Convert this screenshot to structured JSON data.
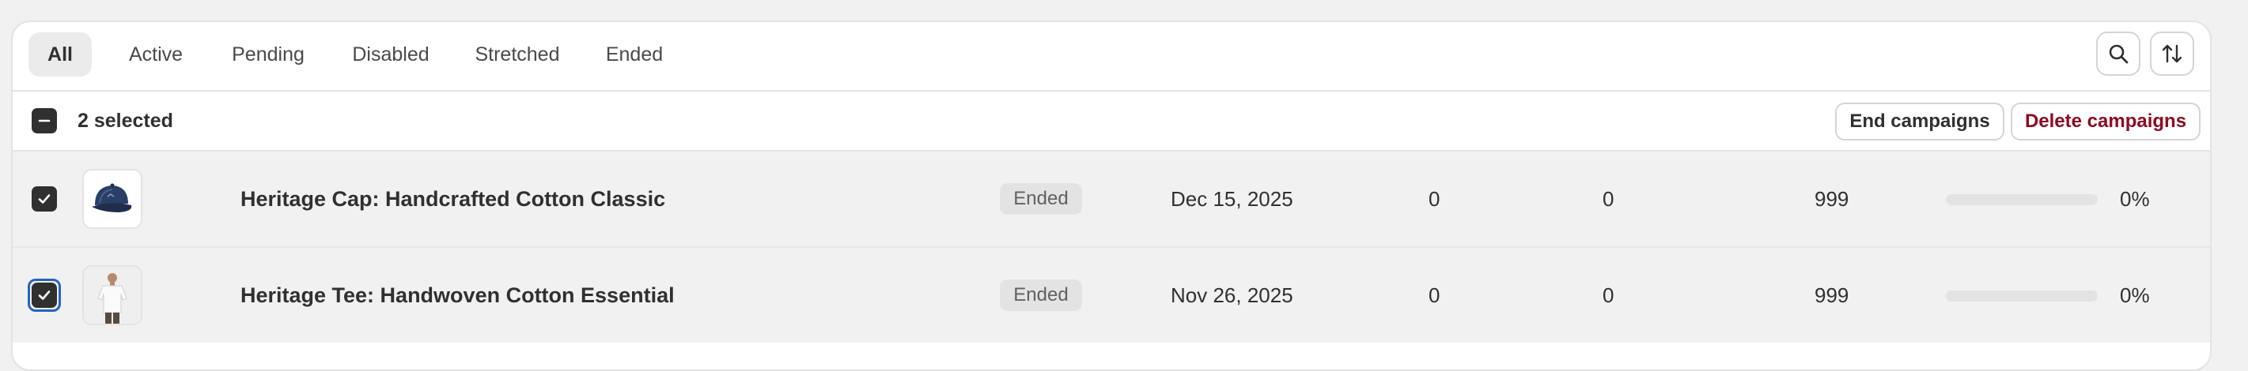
{
  "tabs": [
    {
      "label": "All",
      "active": true
    },
    {
      "label": "Active",
      "active": false
    },
    {
      "label": "Pending",
      "active": false
    },
    {
      "label": "Disabled",
      "active": false
    },
    {
      "label": "Stretched",
      "active": false
    },
    {
      "label": "Ended",
      "active": false
    }
  ],
  "toolbar": {
    "search_icon": "search-icon",
    "sort_icon": "sort-icon"
  },
  "bulk": {
    "selected_label": "2 selected",
    "end_button": "End campaigns",
    "delete_button": "Delete campaigns",
    "colors": {
      "primary_text": "#303030",
      "critical": "#8e0b21"
    }
  },
  "rows": [
    {
      "title": "Heritage Cap: Handcrafted Cotton Classic",
      "status": "Ended",
      "date": "Dec 15, 2025",
      "col1": "0",
      "col2": "0",
      "col3": "999",
      "progress": 0,
      "percent": "0%",
      "checked": true,
      "focused": false,
      "thumbnail": "cap-image"
    },
    {
      "title": "Heritage Tee: Handwoven Cotton Essential",
      "status": "Ended",
      "date": "Nov 26, 2025",
      "col1": "0",
      "col2": "0",
      "col3": "999",
      "progress": 0,
      "percent": "0%",
      "checked": true,
      "focused": true,
      "thumbnail": "tee-image"
    }
  ]
}
